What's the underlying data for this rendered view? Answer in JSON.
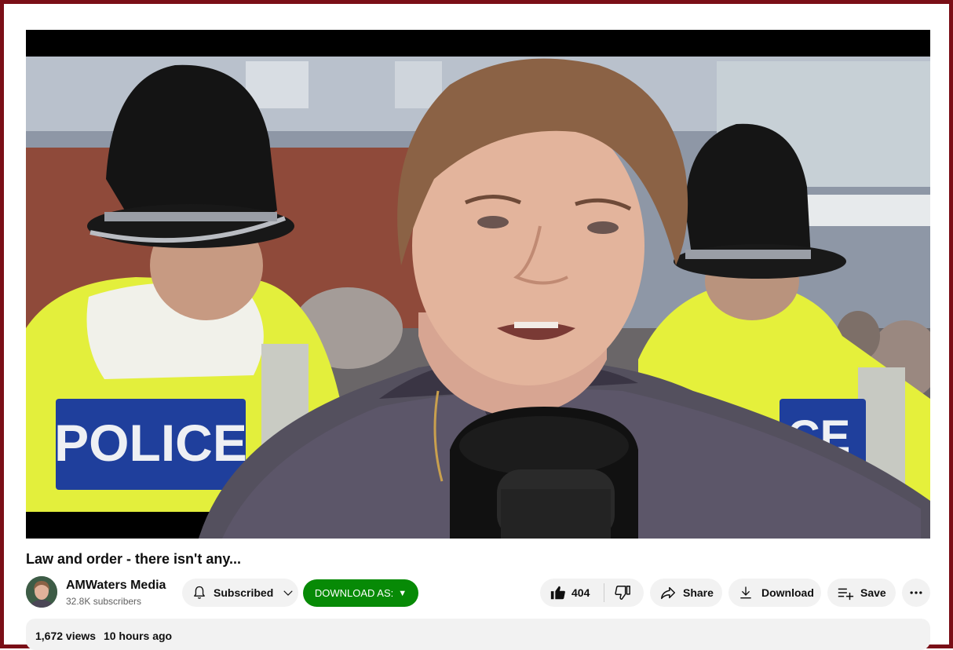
{
  "video": {
    "title": "Law and order - there isn't any...",
    "thumbnail_badge": "POLICE",
    "thumbnail_badge_partial": "CE"
  },
  "channel": {
    "name": "AMWaters Media",
    "subscribers": "32.8K subscribers",
    "avatar_icon": "person-avatar"
  },
  "actions": {
    "subscribed_label": "Subscribed",
    "download_as_label": "DOWNLOAD AS:",
    "download_as_arrow": "▼",
    "like_count": "404",
    "share_label": "Share",
    "download_label": "Download",
    "save_label": "Save"
  },
  "description": {
    "views": "1,672 views",
    "posted": "10 hours ago"
  },
  "colors": {
    "frame_border": "#7a0f17",
    "download_as_bg": "#078a06",
    "pill_bg": "#f2f2f2",
    "hi_vis_yellow": "#e4f03a",
    "police_blue": "#1f3f9c"
  }
}
